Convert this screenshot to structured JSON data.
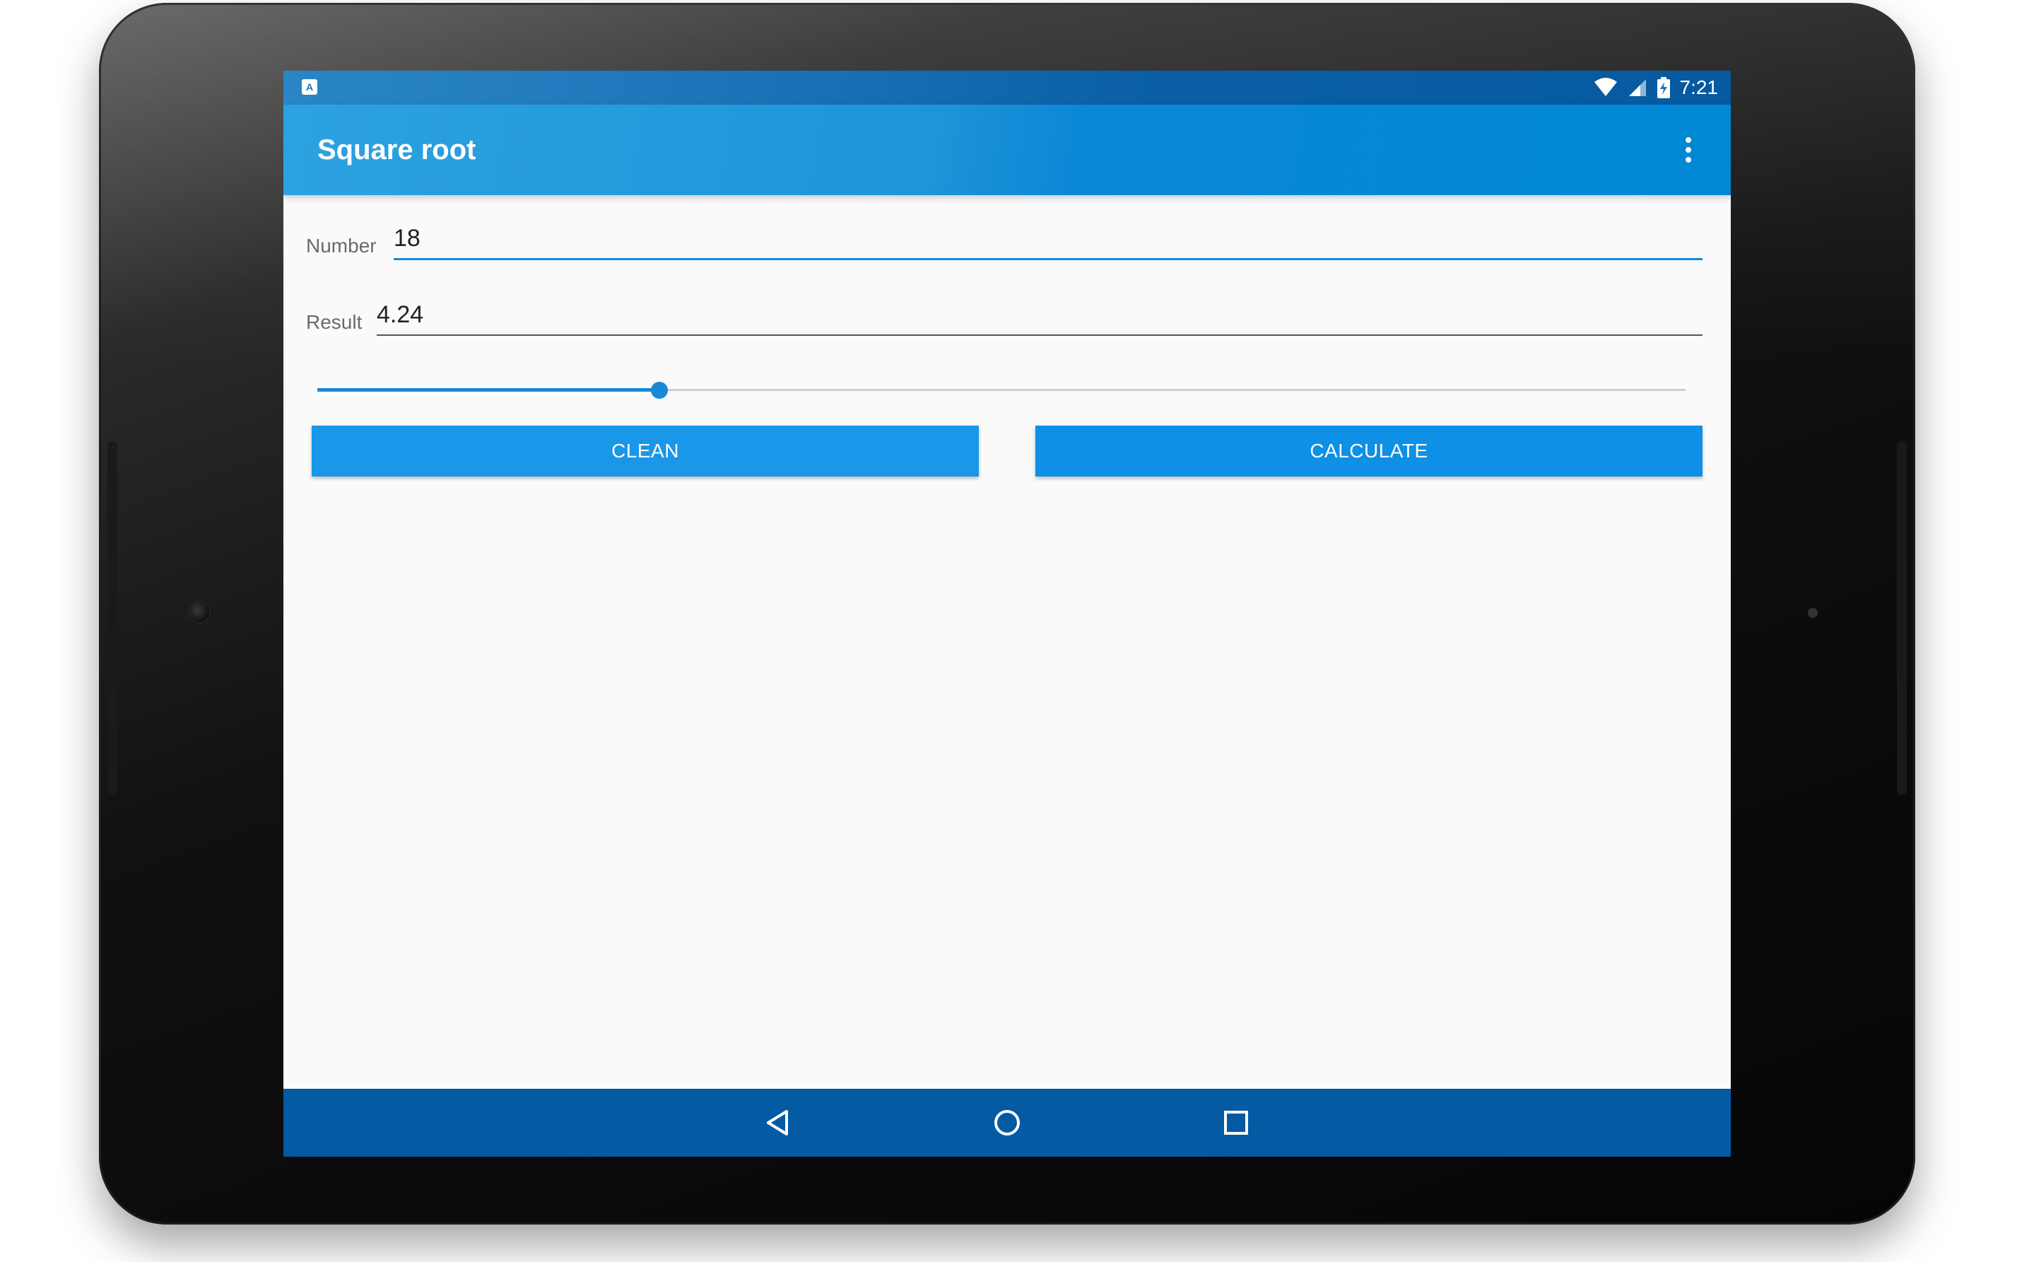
{
  "status_bar": {
    "time": "7:21",
    "notification_icon": "a-badge-icon",
    "icons": [
      "wifi-icon",
      "cellular-signal-icon",
      "battery-charging-icon"
    ]
  },
  "app_bar": {
    "title": "Square root",
    "menu_icon": "overflow-menu-icon"
  },
  "form": {
    "number_label": "Number",
    "number_value": "18",
    "result_label": "Result",
    "result_value": "4.24",
    "slider_value_fraction": 0.25
  },
  "buttons": {
    "clean_label": "CLEAN",
    "calculate_label": "CALCULATE"
  },
  "nav_bar": {
    "icons": [
      "back-icon",
      "home-icon",
      "recents-icon"
    ]
  },
  "colors": {
    "accent": "#1a88d8",
    "app_bar": "#0088d4",
    "status_bar": "#055aa0",
    "nav_bar": "#045aa3",
    "button": "#0d90e6"
  }
}
